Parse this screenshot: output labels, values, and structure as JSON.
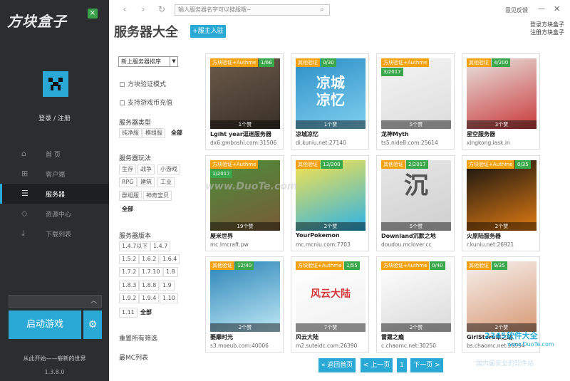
{
  "app": {
    "logo": "方块盒子",
    "logo_badge": "×",
    "login": "登录 / 注册",
    "tagline": "从此开始——崭新的世界",
    "version": "1.3.8.0",
    "launch": "启动游戏"
  },
  "nav": [
    {
      "label": "首  页",
      "icon": "home-icon",
      "glyph": "⌂"
    },
    {
      "label": "客户端",
      "icon": "grid-icon",
      "glyph": "⊞"
    },
    {
      "label": "服务器",
      "icon": "server-icon",
      "glyph": "☰"
    },
    {
      "label": "资源中心",
      "icon": "gem-icon",
      "glyph": "◇"
    },
    {
      "label": "下载列表",
      "icon": "download-icon",
      "glyph": "⤓"
    }
  ],
  "topbar": {
    "search_placeholder": "输入服务器名字可以搜服哦~",
    "feedback": "意见反馈",
    "minimize": "—",
    "close": "✕",
    "login_link": "登录方块盒子",
    "register_link": "注册方块盒子"
  },
  "page": {
    "title": "服务器大全",
    "join": "+服主入驻"
  },
  "filters": {
    "sort": "新上服务器排序",
    "check1": "方块验证模式",
    "check2": "支持游戏币充值",
    "type_title": "服务器类型",
    "types": [
      "纯净服",
      "模组服",
      "全部"
    ],
    "play_title": "服务器玩法",
    "plays": [
      "生存",
      "战争",
      "小游戏",
      "RPG",
      "建筑",
      "工业",
      "群组服",
      "神奇宝贝",
      "全部"
    ],
    "ver_title": "服务器版本",
    "versions": [
      "1.4.7以下",
      "1.4.7",
      "1.5.2",
      "1.6.2",
      "1.6.4",
      "1.7.2",
      "1.7.10",
      "1.8",
      "1.8.3",
      "1.8.8",
      "1.9",
      "1.9.2",
      "1.9.4",
      "1.10",
      "1.11",
      "全部"
    ],
    "reset": "重置所有筛选",
    "best": "最MC列表"
  },
  "servers": [
    {
      "badge": "方块验证+Authme",
      "count": "1/66",
      "likes": "1个赞",
      "name": "Lgiht year逗迷服务器",
      "addr": "dx6.gmboshi.com:31506",
      "art": "",
      "colors": [
        "#6b5a4a",
        "#3a3028"
      ]
    },
    {
      "badge": "其他验证",
      "count": "0/30",
      "likes": "1个赞",
      "name": "凉城凉忆",
      "addr": "di.kuniu.net:27140",
      "art": "凉城\n凉忆",
      "colors": [
        "#2d8fc7",
        "#7fd0ef"
      ]
    },
    {
      "badge": "方块验证+Authme",
      "count": "3/2017",
      "likes": "5个赞",
      "name": "龙神Myth",
      "addr": "ts5.nide8.com:25614",
      "art": "",
      "colors": [
        "#f4f4f4",
        "#dcdcdc"
      ]
    },
    {
      "badge": "其他验证",
      "count": "4/200",
      "likes": "3个赞",
      "name": "星空服务器",
      "addr": "xingkong.iask.in",
      "art": "",
      "colors": [
        "#e8e4e0",
        "#c93a3a"
      ]
    },
    {
      "badge": "方块验证+Authme",
      "count": "1/2017",
      "likes": "19个赞",
      "name": "屋米世界",
      "addr": "mc.lmcraft.pw",
      "art": "",
      "colors": [
        "#4b8e3c",
        "#7a5a36"
      ]
    },
    {
      "badge": "其他验证",
      "count": "13/200",
      "likes": "2个赞",
      "name": "YourPokemon",
      "addr": "mc.mcniu.com:7703",
      "art": "",
      "colors": [
        "#fbe34a",
        "#2cb3e8"
      ]
    },
    {
      "badge": "其他验证",
      "count": "2/2017",
      "likes": "5个赞",
      "name": "Downland沉默之地",
      "addr": "doudou.mclover.cc",
      "art": "沉",
      "colors": [
        "#e6e6e6",
        "#cfcfcf"
      ]
    },
    {
      "badge": "方块验证+Authme",
      "count": "0/35",
      "likes": "2个赞",
      "name": "火原陆服务器",
      "addr": "r.kuniu.net:26921",
      "art": "",
      "colors": [
        "#111111",
        "#e07b12"
      ]
    },
    {
      "badge": "其他验证",
      "count": "12/40",
      "likes": "2个赞",
      "name": "萎靡时光",
      "addr": "s3.moeub.com:40006",
      "art": "",
      "colors": [
        "#2a84b8",
        "#bfe8f5"
      ]
    },
    {
      "badge": "方块验证+Authme",
      "count": "1/55",
      "likes": "7个赞",
      "name": "风云大陆",
      "addr": "m2.suteidc.com:26390",
      "art": "风云大陆",
      "colors": [
        "#ffffff",
        "#f0f0f0"
      ]
    },
    {
      "badge": "方块验证+Authme",
      "count": "0/40",
      "likes": "2个赞",
      "name": "雷霆之瘾",
      "addr": "c.chaomc.net:30250",
      "art": "",
      "colors": [
        "#ffffff",
        "#d9d9d9"
      ]
    },
    {
      "badge": "其他验证",
      "count": "9/35",
      "likes": "2个赞",
      "name": "GirlStore幸之站",
      "addr": "bs.chaomc.net:26554",
      "art": "",
      "colors": [
        "#f6f1ee",
        "#d89a76"
      ]
    }
  ],
  "pager": {
    "home": "« 返回首页",
    "prev": "< 上一页",
    "page": "1",
    "next": "下一页 >"
  },
  "watermarks": {
    "center": "www.DuoTe.com",
    "logo": "2345软件大全",
    "url": "www.DuoTe.com",
    "safe": "国内最安全的软件站"
  },
  "colors": {
    "accent": "#2aa9d6",
    "sidebar": "#2b2d30",
    "badge_orange": "#f2a20f",
    "badge_green": "#3aa84a"
  }
}
